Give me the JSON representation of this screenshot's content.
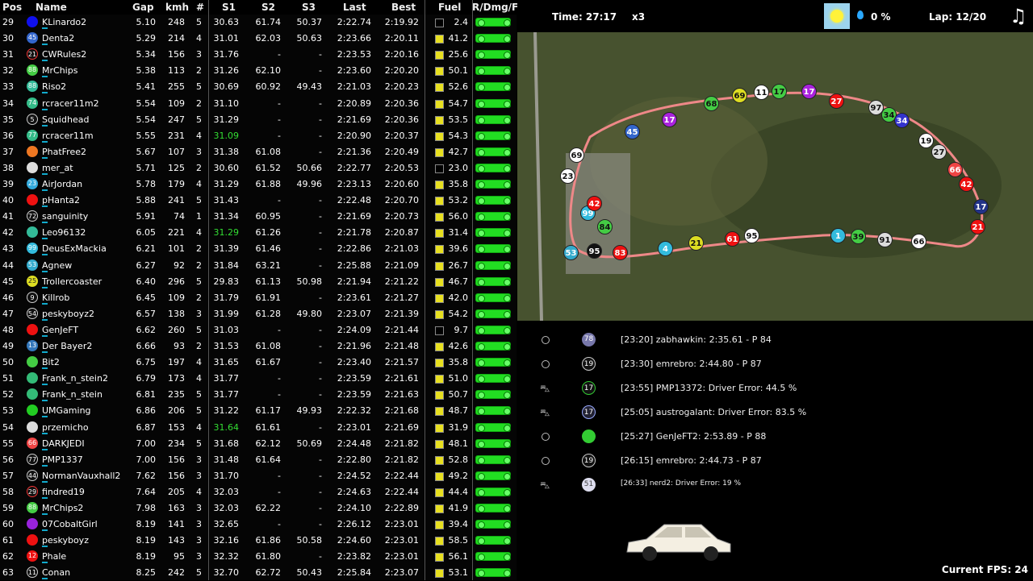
{
  "header": {
    "pos": "Pos",
    "name": "Name",
    "gap": "Gap",
    "kmh": "kmh",
    "num": "#",
    "s1": "S1",
    "s2": "S2",
    "s3": "S3",
    "last": "Last",
    "best": "Best",
    "fuel": "Fuel",
    "rdmg": "R/Dmg/F"
  },
  "rows": [
    {
      "pos": "29",
      "badge": "",
      "badge_color": "#1010ee",
      "name": "KLinardo2",
      "gap": "5.10",
      "kmh": "248",
      "num": "5",
      "s1": "30.63",
      "s2": "61.74",
      "s3": "50.37",
      "last": "2:22.74",
      "best": "2:19.92",
      "fuel": "2.4"
    },
    {
      "pos": "30",
      "badge": "45",
      "badge_color": "#3366cc",
      "name": "Denta2",
      "gap": "5.29",
      "kmh": "214",
      "num": "4",
      "s1": "31.01",
      "s2": "62.03",
      "s3": "50.63",
      "last": "2:23.66",
      "best": "2:20.11",
      "fuel": "41.2"
    },
    {
      "pos": "31",
      "badge": "21",
      "badge_color": "outline-red",
      "name": "CWRules2",
      "gap": "5.34",
      "kmh": "156",
      "num": "3",
      "s1": "31.76",
      "s2": "-",
      "s3": "-",
      "last": "2:23.53",
      "best": "2:20.16",
      "fuel": "25.6"
    },
    {
      "pos": "32",
      "badge": "88",
      "badge_color": "#44cc44",
      "name": "MrChips",
      "gap": "5.38",
      "kmh": "113",
      "num": "2",
      "s1": "31.26",
      "s2": "62.10",
      "s3": "-",
      "last": "2:23.60",
      "best": "2:20.20",
      "fuel": "50.1"
    },
    {
      "pos": "33",
      "badge": "88",
      "badge_color": "#33bb99",
      "name": "Riso2",
      "gap": "5.41",
      "kmh": "255",
      "num": "5",
      "s1": "30.69",
      "s2": "60.92",
      "s3": "49.43",
      "last": "2:21.03",
      "best": "2:20.23",
      "fuel": "52.6"
    },
    {
      "pos": "34",
      "badge": "74",
      "badge_color": "#33bb88",
      "name": "rcracer11m2",
      "gap": "5.54",
      "kmh": "109",
      "num": "2",
      "s1": "31.10",
      "s2": "-",
      "s3": "-",
      "last": "2:20.89",
      "best": "2:20.36",
      "fuel": "54.7"
    },
    {
      "pos": "35",
      "badge": "5",
      "badge_color": "outline",
      "name": "Squidhead",
      "gap": "5.54",
      "kmh": "247",
      "num": "5",
      "s1": "31.29",
      "s2": "-",
      "s3": "-",
      "last": "2:21.69",
      "best": "2:20.36",
      "fuel": "53.5"
    },
    {
      "pos": "36",
      "badge": "77",
      "badge_color": "#33bb88",
      "name": "rcracer11m",
      "gap": "5.55",
      "kmh": "231",
      "num": "4",
      "s1": "31.09",
      "s1_green": true,
      "s2": "-",
      "s3": "-",
      "last": "2:20.90",
      "best": "2:20.37",
      "fuel": "54.3"
    },
    {
      "pos": "37",
      "badge": "",
      "badge_color": "#ee7722",
      "name": "PhatFree2",
      "gap": "5.67",
      "kmh": "107",
      "num": "3",
      "s1": "31.38",
      "s2": "61.08",
      "s3": "-",
      "last": "2:21.36",
      "best": "2:20.49",
      "fuel": "42.7"
    },
    {
      "pos": "38",
      "badge": "",
      "badge_color": "#dddddd",
      "name": "mer_at",
      "gap": "5.71",
      "kmh": "125",
      "num": "2",
      "s1": "30.60",
      "s2": "61.52",
      "s3": "50.66",
      "last": "2:22.77",
      "best": "2:20.53",
      "fuel": "23.0"
    },
    {
      "pos": "39",
      "badge": "23",
      "badge_color": "#33aadd",
      "name": "AirJordan",
      "gap": "5.78",
      "kmh": "179",
      "num": "4",
      "s1": "31.29",
      "s2": "61.88",
      "s3": "49.96",
      "last": "2:23.13",
      "best": "2:20.60",
      "fuel": "35.8"
    },
    {
      "pos": "40",
      "badge": "",
      "badge_color": "#ee1111",
      "name": "pHanta2",
      "gap": "5.88",
      "kmh": "241",
      "num": "5",
      "s1": "31.43",
      "s2": "-",
      "s3": "-",
      "last": "2:22.48",
      "best": "2:20.70",
      "fuel": "53.2"
    },
    {
      "pos": "41",
      "badge": "72",
      "badge_color": "outline",
      "name": "sanguinity",
      "gap": "5.91",
      "kmh": "74",
      "num": "1",
      "s1": "31.34",
      "s2": "60.95",
      "s3": "-",
      "last": "2:21.69",
      "best": "2:20.73",
      "fuel": "56.0"
    },
    {
      "pos": "42",
      "badge": "",
      "badge_color": "#33bb99",
      "name": "Leo96132",
      "gap": "6.05",
      "kmh": "221",
      "num": "4",
      "s1": "31.29",
      "s1_green": true,
      "s2": "61.26",
      "s3": "-",
      "last": "2:21.78",
      "best": "2:20.87",
      "fuel": "31.4"
    },
    {
      "pos": "43",
      "badge": "99",
      "badge_color": "#33bbdd",
      "name": "DeusExMackia",
      "gap": "6.21",
      "kmh": "101",
      "num": "2",
      "s1": "31.39",
      "s2": "61.46",
      "s3": "-",
      "last": "2:22.86",
      "best": "2:21.03",
      "fuel": "39.6"
    },
    {
      "pos": "44",
      "badge": "53",
      "badge_color": "#33aacc",
      "name": "Agnew",
      "gap": "6.27",
      "kmh": "92",
      "num": "2",
      "s1": "31.84",
      "s2": "63.21",
      "s3": "-",
      "last": "2:25.88",
      "best": "2:21.09",
      "fuel": "26.7"
    },
    {
      "pos": "45",
      "badge": "25",
      "badge_color": "#dddd22",
      "name": "Trollercoaster",
      "gap": "6.40",
      "kmh": "296",
      "num": "5",
      "s1": "29.83",
      "s2": "61.13",
      "s3": "50.98",
      "last": "2:21.94",
      "best": "2:21.22",
      "fuel": "46.7"
    },
    {
      "pos": "46",
      "badge": "9",
      "badge_color": "outline",
      "name": "Killrob",
      "gap": "6.45",
      "kmh": "109",
      "num": "2",
      "s1": "31.79",
      "s2": "61.91",
      "s3": "-",
      "last": "2:23.61",
      "best": "2:21.27",
      "fuel": "42.0"
    },
    {
      "pos": "47",
      "badge": "54",
      "badge_color": "outline",
      "name": "peskyboyz2",
      "gap": "6.57",
      "kmh": "138",
      "num": "3",
      "s1": "31.99",
      "s2": "61.28",
      "s3": "49.80",
      "last": "2:23.07",
      "best": "2:21.39",
      "fuel": "54.2"
    },
    {
      "pos": "48",
      "badge": "",
      "badge_color": "#ee1111",
      "name": "GenJeFT",
      "gap": "6.62",
      "kmh": "260",
      "num": "5",
      "s1": "31.03",
      "s2": "-",
      "s3": "-",
      "last": "2:24.09",
      "best": "2:21.44",
      "fuel": "9.7"
    },
    {
      "pos": "49",
      "badge": "13",
      "badge_color": "#3377bb",
      "name": "Der Bayer2",
      "gap": "6.66",
      "kmh": "93",
      "num": "2",
      "s1": "31.53",
      "s2": "61.08",
      "s3": "-",
      "last": "2:21.96",
      "best": "2:21.48",
      "fuel": "42.6"
    },
    {
      "pos": "50",
      "badge": "",
      "badge_color": "#44cc44",
      "name": "Bit2",
      "gap": "6.75",
      "kmh": "197",
      "num": "4",
      "s1": "31.65",
      "s2": "61.67",
      "s3": "-",
      "last": "2:23.40",
      "best": "2:21.57",
      "fuel": "35.8"
    },
    {
      "pos": "51",
      "badge": "",
      "badge_color": "#33bb77",
      "name": "Frank_n_stein2",
      "gap": "6.79",
      "kmh": "173",
      "num": "4",
      "s1": "31.77",
      "s2": "-",
      "s3": "-",
      "last": "2:23.59",
      "best": "2:21.61",
      "fuel": "51.0"
    },
    {
      "pos": "52",
      "badge": "",
      "badge_color": "#33bb77",
      "name": "Frank_n_stein",
      "gap": "6.81",
      "kmh": "235",
      "num": "5",
      "s1": "31.77",
      "s2": "-",
      "s3": "-",
      "last": "2:23.59",
      "best": "2:21.63",
      "fuel": "50.7"
    },
    {
      "pos": "53",
      "badge": "",
      "badge_color": "#22cc22",
      "name": "UMGaming",
      "gap": "6.86",
      "kmh": "206",
      "num": "5",
      "s1": "31.22",
      "s2": "61.17",
      "s3": "49.93",
      "last": "2:22.32",
      "best": "2:21.68",
      "fuel": "48.7"
    },
    {
      "pos": "54",
      "badge": "",
      "badge_color": "#dddddd",
      "name": "przemicho",
      "gap": "6.87",
      "kmh": "153",
      "num": "4",
      "s1": "31.64",
      "s1_green": true,
      "s2": "61.61",
      "s3": "-",
      "last": "2:23.01",
      "best": "2:21.69",
      "fuel": "31.9"
    },
    {
      "pos": "55",
      "badge": "66",
      "badge_color": "#ee4444",
      "name": "DARKJEDI",
      "gap": "7.00",
      "kmh": "234",
      "num": "5",
      "s1": "31.68",
      "s2": "62.12",
      "s3": "50.69",
      "last": "2:24.48",
      "best": "2:21.82",
      "fuel": "48.1"
    },
    {
      "pos": "56",
      "badge": "77",
      "badge_color": "outline",
      "name": "PMP1337",
      "gap": "7.00",
      "kmh": "156",
      "num": "3",
      "s1": "31.48",
      "s2": "61.64",
      "s3": "-",
      "last": "2:22.80",
      "best": "2:21.82",
      "fuel": "52.8"
    },
    {
      "pos": "57",
      "badge": "44",
      "badge_color": "outline",
      "name": "NormanVauxhall2",
      "gap": "7.62",
      "kmh": "156",
      "num": "3",
      "s1": "31.70",
      "s2": "-",
      "s3": "-",
      "last": "2:24.52",
      "best": "2:22.44",
      "fuel": "49.2"
    },
    {
      "pos": "58",
      "badge": "29",
      "badge_color": "outline-red",
      "name": "findred19",
      "gap": "7.64",
      "kmh": "205",
      "num": "4",
      "s1": "32.03",
      "s2": "-",
      "s3": "-",
      "last": "2:24.63",
      "best": "2:22.44",
      "fuel": "44.4"
    },
    {
      "pos": "59",
      "badge": "88",
      "badge_color": "#44cc44",
      "name": "MrChips2",
      "gap": "7.98",
      "kmh": "163",
      "num": "3",
      "s1": "32.03",
      "s2": "62.22",
      "s3": "-",
      "last": "2:24.10",
      "best": "2:22.89",
      "fuel": "41.9"
    },
    {
      "pos": "60",
      "badge": "",
      "badge_color": "#9922dd",
      "name": "07CobaltGirl",
      "gap": "8.19",
      "kmh": "141",
      "num": "3",
      "s1": "32.65",
      "s2": "-",
      "s3": "-",
      "last": "2:26.12",
      "best": "2:23.01",
      "fuel": "39.4"
    },
    {
      "pos": "61",
      "badge": "",
      "badge_color": "#ee1111",
      "name": "peskyboyz",
      "gap": "8.19",
      "kmh": "143",
      "num": "3",
      "s1": "32.16",
      "s2": "61.86",
      "s3": "50.58",
      "last": "2:24.60",
      "best": "2:23.01",
      "fuel": "58.5"
    },
    {
      "pos": "62",
      "badge": "12",
      "badge_color": "#ee1111",
      "name": "Phale",
      "gap": "8.19",
      "kmh": "95",
      "num": "3",
      "s1": "32.32",
      "s2": "61.80",
      "s3": "-",
      "last": "2:23.82",
      "best": "2:23.01",
      "fuel": "56.1"
    },
    {
      "pos": "63",
      "badge": "11",
      "badge_color": "outline",
      "name": "Conan",
      "gap": "8.25",
      "kmh": "242",
      "num": "5",
      "s1": "32.70",
      "s2": "62.72",
      "s3": "50.43",
      "last": "2:25.84",
      "best": "2:23.07",
      "fuel": "53.1"
    }
  ],
  "status": {
    "time": "Time: 27:17",
    "speed": "x3",
    "rain": "0 %",
    "lap": "Lap: 12/20"
  },
  "map_markers": [
    {
      "n": "69",
      "c": "#dddd22"
    },
    {
      "n": "11",
      "c": "#ffffff"
    },
    {
      "n": "17",
      "c": "#44cc44"
    },
    {
      "n": "17",
      "c": "#aa22dd"
    },
    {
      "n": "27",
      "c": "#ee1111"
    },
    {
      "n": "97",
      "c": "#dddddd"
    },
    {
      "n": "34",
      "c": "#44cc44"
    },
    {
      "n": "34",
      "c": "#3333cc"
    },
    {
      "n": "19",
      "c": "#ffffff"
    },
    {
      "n": "27",
      "c": "#dddddd"
    },
    {
      "n": "66",
      "c": "#ee4444"
    },
    {
      "n": "42",
      "c": "#ee1111"
    },
    {
      "n": "17",
      "c": "#223388"
    },
    {
      "n": "21",
      "c": "#ee1111"
    },
    {
      "n": "1",
      "c": "#33bbdd"
    },
    {
      "n": "39",
      "c": "#44cc44"
    },
    {
      "n": "91",
      "c": "#dddddd"
    },
    {
      "n": "66",
      "c": "#ffffff"
    },
    {
      "n": "21",
      "c": "#dddd22"
    },
    {
      "n": "61",
      "c": "#ee1111"
    },
    {
      "n": "95",
      "c": "#ffffff"
    },
    {
      "n": "4",
      "c": "#33bbdd"
    },
    {
      "n": "83",
      "c": "#ee1111"
    },
    {
      "n": "95",
      "c": "#111111"
    },
    {
      "n": "53",
      "c": "#33aacc"
    },
    {
      "n": "84",
      "c": "#44cc44"
    },
    {
      "n": "99",
      "c": "#33bbdd"
    },
    {
      "n": "42",
      "c": "#ee1111"
    },
    {
      "n": "23",
      "c": "#ffffff"
    },
    {
      "n": "69",
      "c": "#ffffff"
    },
    {
      "n": "45",
      "c": "#3366cc"
    },
    {
      "n": "17",
      "c": "#aa22dd"
    },
    {
      "n": "68",
      "c": "#44cc44"
    }
  ],
  "events": [
    {
      "type": "lap",
      "badge": "78",
      "badge_color": "#7777aa",
      "text": "[23:20] zabhawkin: 2:35.61 - P 84"
    },
    {
      "type": "lap",
      "badge": "19",
      "badge_color": "outline",
      "text": "[23:30] emrebro: 2:44.80 - P 87"
    },
    {
      "type": "error",
      "badge": "17",
      "badge_color": "outline-green",
      "text": "[23:55] PMP13372: Driver Error: 44.5 %"
    },
    {
      "type": "error",
      "badge": "17",
      "badge_color": "outline-blue",
      "text": "[25:05] austrogalant: Driver Error: 83.5 %"
    },
    {
      "type": "lap",
      "badge": "",
      "badge_color": "#33cc33",
      "text": "[25:27] GenJeFT2: 2:53.89 - P 88"
    },
    {
      "type": "lap",
      "badge": "19",
      "badge_color": "outline",
      "text": "[26:15] emrebro: 2:44.73 - P 87"
    },
    {
      "type": "error",
      "badge": "51",
      "badge_color": "#ddddee",
      "text": "[26:33] nerd2: Driver Error: 19 %"
    }
  ],
  "fps": "Current FPS: 24"
}
